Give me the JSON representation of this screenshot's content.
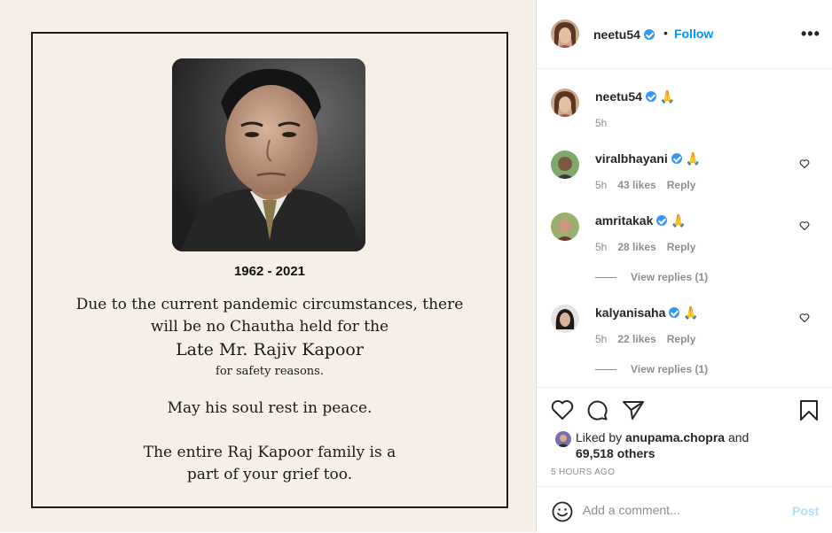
{
  "post": {
    "years": "1962 - 2021",
    "message": {
      "line1": "Due to the current pandemic circumstances, there",
      "line2": "will be no Chautha held for the",
      "line3": "Late Mr. Rajiv Kapoor",
      "line4": "for safety reasons.",
      "line5": "May his soul rest in peace.",
      "line6": "The entire Raj Kapoor family is a",
      "line7": "part of your grief too."
    }
  },
  "header": {
    "username": "neetu54",
    "separator": "•",
    "follow_label": "Follow",
    "more_label": "•••"
  },
  "caption": {
    "username": "neetu54",
    "text": "🙏",
    "time": "5h"
  },
  "comments": [
    {
      "username": "viralbhayani",
      "text": "🙏",
      "time": "5h",
      "likes": "43 likes",
      "reply_label": "Reply"
    },
    {
      "username": "amritakak",
      "text": "🙏",
      "time": "5h",
      "likes": "28 likes",
      "reply_label": "Reply",
      "view_replies": "View replies (1)"
    },
    {
      "username": "kalyanisaha",
      "text": "🙏",
      "time": "5h",
      "likes": "22 likes",
      "reply_label": "Reply",
      "view_replies": "View replies (1)"
    }
  ],
  "likes": {
    "prefix": "Liked by ",
    "user": "anupama.chopra",
    "conjunction": " and",
    "count": "69,518 others"
  },
  "timestamp": "5 HOURS AGO",
  "comment_box": {
    "placeholder": "Add a comment...",
    "post_label": "Post"
  },
  "colors": {
    "accent": "#0095f6",
    "verified": "#3897f0",
    "card_background": "#f5efe7"
  }
}
